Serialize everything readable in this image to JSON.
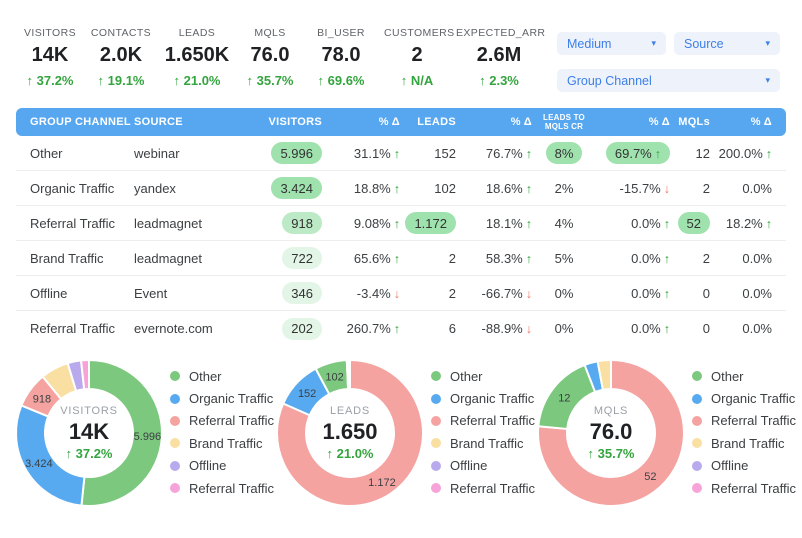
{
  "kpis": [
    {
      "label": "VISITORS",
      "value": "14K",
      "delta": "37.2%",
      "delta_dir": "up"
    },
    {
      "label": "CONTACTS",
      "value": "2.0K",
      "delta": "19.1%",
      "delta_dir": "up"
    },
    {
      "label": "LEADS",
      "value": "1.650K",
      "delta": "21.0%",
      "delta_dir": "up"
    },
    {
      "label": "MQLS",
      "value": "76.0",
      "delta": "35.7%",
      "delta_dir": "up"
    },
    {
      "label": "BI_USER",
      "value": "78.0",
      "delta": "69.6%",
      "delta_dir": "up"
    },
    {
      "label": "CUSTOMERS",
      "value": "2",
      "delta": "N/A",
      "delta_dir": "up"
    },
    {
      "label": "EXPECTED_ARR",
      "value": "2.6M",
      "delta": "2.3%",
      "delta_dir": "up"
    }
  ],
  "filters": {
    "medium": "Medium",
    "source": "Source",
    "group_channel": "Group Channel"
  },
  "table": {
    "columns": [
      "GROUP CHANNEL",
      "SOURCE",
      "VISITORS",
      "% Δ",
      "LEADS",
      "% Δ",
      "LEADS TO MQLS CR",
      "% Δ",
      "MQLs",
      "% Δ"
    ],
    "rows": [
      {
        "group_channel": "Other",
        "source": "webinar",
        "metrics": [
          {
            "t": "5.996",
            "bg": "#9fe2ae"
          },
          {
            "t": "31.1%",
            "dir": "up"
          },
          {
            "t": "152"
          },
          {
            "t": "76.7%",
            "dir": "up"
          },
          {
            "t": "8%",
            "bg": "#9fe2ae"
          },
          {
            "t": "69.7%",
            "dir": "up",
            "bg": "#9fe2ae"
          },
          {
            "t": "12"
          },
          {
            "t": "200.0%",
            "dir": "up"
          }
        ]
      },
      {
        "group_channel": "Organic Traffic",
        "source": "yandex",
        "metrics": [
          {
            "t": "3.424",
            "bg": "#9fe2ae"
          },
          {
            "t": "18.8%",
            "dir": "up"
          },
          {
            "t": "102"
          },
          {
            "t": "18.6%",
            "dir": "up"
          },
          {
            "t": "2%"
          },
          {
            "t": "-15.7%",
            "dir": "down"
          },
          {
            "t": "2"
          },
          {
            "t": "0.0%"
          }
        ]
      },
      {
        "group_channel": "Referral Traffic",
        "source": "leadmagnet",
        "metrics": [
          {
            "t": "918",
            "bg": "#bdeac6"
          },
          {
            "t": "9.08%",
            "dir": "up"
          },
          {
            "t": "1.172",
            "bg": "#9fe2ae"
          },
          {
            "t": "18.1%",
            "dir": "up"
          },
          {
            "t": "4%"
          },
          {
            "t": "0.0%",
            "dir": "up"
          },
          {
            "t": "52",
            "bg": "#9fe2ae"
          },
          {
            "t": "18.2%",
            "dir": "up"
          }
        ]
      },
      {
        "group_channel": "Brand Traffic",
        "source": "leadmagnet",
        "metrics": [
          {
            "t": "722",
            "bg": "#e3f5e7"
          },
          {
            "t": "65.6%",
            "dir": "up"
          },
          {
            "t": "2"
          },
          {
            "t": "58.3%",
            "dir": "up"
          },
          {
            "t": "5%"
          },
          {
            "t": "0.0%",
            "dir": "up"
          },
          {
            "t": "2"
          },
          {
            "t": "0.0%"
          }
        ]
      },
      {
        "group_channel": "Offline",
        "source": "Event",
        "metrics": [
          {
            "t": "346",
            "bg": "#e3f5e7"
          },
          {
            "t": "-3.4%",
            "dir": "down"
          },
          {
            "t": "2"
          },
          {
            "t": "-66.7%",
            "dir": "down"
          },
          {
            "t": "0%"
          },
          {
            "t": "0.0%",
            "dir": "up"
          },
          {
            "t": "0"
          },
          {
            "t": "0.0%"
          }
        ]
      },
      {
        "group_channel": "Referral Traffic",
        "source": "evernote.com",
        "metrics": [
          {
            "t": "202",
            "bg": "#e3f5e7"
          },
          {
            "t": "260.7%",
            "dir": "up"
          },
          {
            "t": "6"
          },
          {
            "t": "-88.9%",
            "dir": "down"
          },
          {
            "t": "0%"
          },
          {
            "t": "0.0%",
            "dir": "up"
          },
          {
            "t": "0"
          },
          {
            "t": "0.0%"
          }
        ]
      }
    ]
  },
  "chart_data": [
    {
      "type": "pie",
      "title": "VISITORS",
      "center_value": "14K",
      "center_delta": "37.2%",
      "delta_dir": "up",
      "segments": [
        {
          "name": "Other",
          "value": 5996,
          "label": "5.996",
          "color": "#7cc87e"
        },
        {
          "name": "Organic Traffic",
          "value": 3424,
          "label": "3.424",
          "color": "#58aaf0"
        },
        {
          "name": "Referral Traffic",
          "value": 918,
          "label": "918",
          "color": "#f4a3a0"
        },
        {
          "name": "Brand Traffic",
          "value": 722,
          "label": "",
          "color": "#fadfa2"
        },
        {
          "name": "Offline",
          "value": 346,
          "label": "",
          "color": "#b9aaee"
        },
        {
          "name": "Referral Traffic",
          "value": 202,
          "label": "",
          "color": "#f7a3da"
        }
      ],
      "legend": [
        {
          "label": "Other",
          "color": "#7cc87e"
        },
        {
          "label": "Organic Traffic",
          "color": "#58aaf0"
        },
        {
          "label": "Referral Traffic",
          "color": "#f4a3a0"
        },
        {
          "label": "Brand Traffic",
          "color": "#fadfa2"
        },
        {
          "label": "Offline",
          "color": "#b9aaee"
        },
        {
          "label": "Referral Traffic",
          "color": "#f7a3da"
        }
      ]
    },
    {
      "type": "pie",
      "title": "LEADS",
      "center_value": "1.650",
      "center_delta": "21.0%",
      "delta_dir": "up",
      "segments": [
        {
          "name": "Referral Traffic",
          "value": 1172,
          "label": "1.172",
          "color": "#f4a3a0"
        },
        {
          "name": "Organic Traffic",
          "value": 152,
          "label": "152",
          "color": "#58aaf0"
        },
        {
          "name": "Other",
          "value": 102,
          "label": "102",
          "color": "#7cc87e"
        },
        {
          "name": "Referral Traffic",
          "value": 6,
          "label": "",
          "color": "#f7a3da"
        },
        {
          "name": "Brand Traffic",
          "value": 2,
          "label": "",
          "color": "#fadfa2"
        },
        {
          "name": "Offline",
          "value": 2,
          "label": "",
          "color": "#b9aaee"
        }
      ],
      "legend": [
        {
          "label": "Other",
          "color": "#7cc87e"
        },
        {
          "label": "Organic Traffic",
          "color": "#58aaf0"
        },
        {
          "label": "Referral Traffic",
          "color": "#f4a3a0"
        },
        {
          "label": "Brand Traffic",
          "color": "#fadfa2"
        },
        {
          "label": "Offline",
          "color": "#b9aaee"
        },
        {
          "label": "Referral Traffic",
          "color": "#f7a3da"
        }
      ]
    },
    {
      "type": "pie",
      "title": "MQLS",
      "center_value": "76.0",
      "center_delta": "35.7%",
      "delta_dir": "up",
      "segments": [
        {
          "name": "Referral Traffic",
          "value": 52,
          "label": "52",
          "color": "#f4a3a0"
        },
        {
          "name": "Other",
          "value": 12,
          "label": "12",
          "color": "#7cc87e"
        },
        {
          "name": "Organic Traffic",
          "value": 2,
          "label": "",
          "color": "#58aaf0"
        },
        {
          "name": "Brand Traffic",
          "value": 2,
          "label": "",
          "color": "#fadfa2"
        }
      ],
      "legend": [
        {
          "label": "Other",
          "color": "#7cc87e"
        },
        {
          "label": "Organic Traffic",
          "color": "#58aaf0"
        },
        {
          "label": "Referral Traffic",
          "color": "#f4a3a0"
        },
        {
          "label": "Brand Traffic",
          "color": "#fadfa2"
        },
        {
          "label": "Offline",
          "color": "#b9aaee"
        },
        {
          "label": "Referral Traffic",
          "color": "#f7a3da"
        }
      ]
    }
  ],
  "colors": {
    "header_blue": "#57a7f0",
    "positive_green": "#34a43e",
    "negative_red": "#f07466",
    "badge_strong": "#9fe2ae",
    "badge_mid": "#bdeac6",
    "badge_light": "#e3f5e7",
    "filter_bg": "#edf2fb",
    "filter_text": "#3d7fe9"
  },
  "icons": {
    "caret": "▾",
    "arrow_up": "↑",
    "arrow_down": "↓"
  }
}
